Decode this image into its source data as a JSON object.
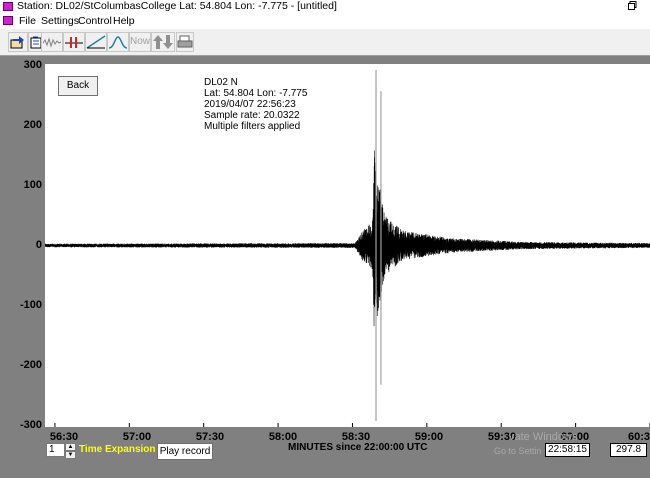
{
  "window": {
    "title": "Station: DL02/StColumbasCollege Lat: 54.804 Lon: -7.775 - [untitled]"
  },
  "menu": [
    "File",
    "Settings",
    "Control",
    "Help"
  ],
  "toolbar": {
    "now_label": "Now"
  },
  "buttons": {
    "back": "Back",
    "play_record": "Play record"
  },
  "info": {
    "station": "DL02  N",
    "coords": "Lat: 54.804 Lon: -7.775",
    "datetime": "2019/04/07 22:56:23",
    "sample_rate": "Sample rate: 20.0322",
    "filters": "Multiple filters applied"
  },
  "controls": {
    "time_expansion_value": "1",
    "time_expansion_label": "Time Expansion",
    "cursor_time": "22:58:15",
    "cursor_value": "297.8"
  },
  "watermark": {
    "line1": "vate Windows",
    "line2": "Go to Settings to activate Windows."
  },
  "chart_data": {
    "type": "line",
    "xlabel": "MINUTES since 22:00:00 UTC",
    "ylabel": "",
    "x_ticks": [
      "56:30",
      "57:00",
      "57:30",
      "58:00",
      "58:30",
      "59:00",
      "59:30",
      "60:00",
      "60:3"
    ],
    "y_ticks": [
      "300",
      "200",
      "100",
      "0",
      "-100",
      "-200",
      "-300"
    ],
    "xlim": [
      "56:26",
      "60:30"
    ],
    "ylim": [
      -300,
      300
    ],
    "series": [
      {
        "values_note": "seismogram amplitude, approximate envelope",
        "envelope": [
          {
            "t": "56:26",
            "amp": 3
          },
          {
            "t": "58:31",
            "amp": 4
          },
          {
            "t": "58:34",
            "amp": 25
          },
          {
            "t": "58:38",
            "amp": 40
          },
          {
            "t": "58:39",
            "amp": 175
          },
          {
            "t": "58:40",
            "amp": 120
          },
          {
            "t": "58:43",
            "amp": 50
          },
          {
            "t": "58:50",
            "amp": 25
          },
          {
            "t": "59:10",
            "amp": 12
          },
          {
            "t": "59:40",
            "amp": 6
          },
          {
            "t": "60:30",
            "amp": 4
          }
        ]
      }
    ],
    "markers": [
      {
        "t": "58:39.5",
        "y_top": 290,
        "y_bottom": -290
      },
      {
        "t": "58:41.5",
        "y_top": 255,
        "y_bottom": -230
      }
    ],
    "colors": {
      "trace": "#000000",
      "marker": "#a0a0a0",
      "background": "#ffffff",
      "frame": "#808080"
    }
  }
}
